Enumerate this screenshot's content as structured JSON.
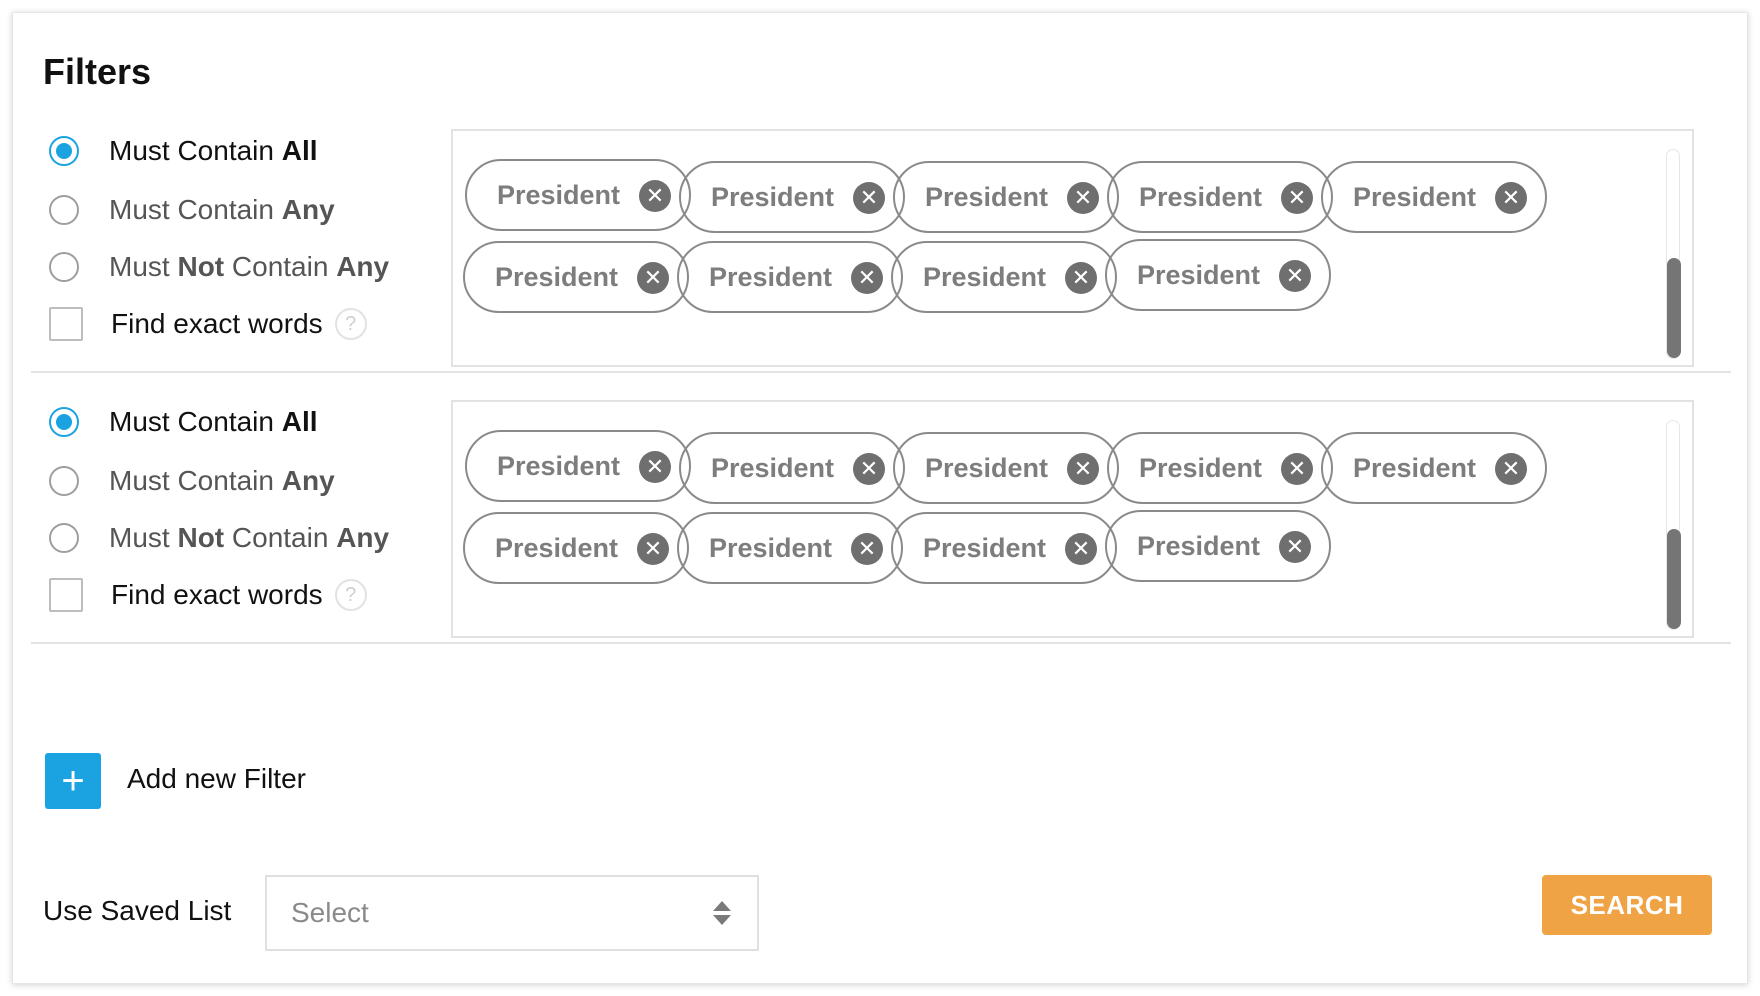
{
  "title": "Filters",
  "filters": [
    {
      "options": [
        {
          "pre": "Must Contain ",
          "bold1": "All",
          "mid": "",
          "bold2": "",
          "selected": true
        },
        {
          "pre": "Must Contain ",
          "bold1": "Any",
          "mid": "",
          "bold2": "",
          "selected": false
        },
        {
          "pre": "Must ",
          "bold1": "Not",
          "mid": " Contain ",
          "bold2": "Any",
          "selected": false
        }
      ],
      "exact_label": "Find exact words",
      "help_glyph": "?",
      "tags": [
        "President",
        "President",
        "President",
        "President",
        "President",
        "President",
        "President",
        "President",
        "President"
      ]
    },
    {
      "options": [
        {
          "pre": "Must Contain ",
          "bold1": "All",
          "mid": "",
          "bold2": "",
          "selected": true
        },
        {
          "pre": "Must Contain ",
          "bold1": "Any",
          "mid": "",
          "bold2": "",
          "selected": false
        },
        {
          "pre": "Must ",
          "bold1": "Not",
          "mid": " Contain ",
          "bold2": "Any",
          "selected": false
        }
      ],
      "exact_label": "Find exact words",
      "help_glyph": "?",
      "tags": [
        "President",
        "President",
        "President",
        "President",
        "President",
        "President",
        "President",
        "President",
        "President"
      ]
    }
  ],
  "add_filter": {
    "icon": "+",
    "label": "Add new Filter"
  },
  "saved_list": {
    "label": "Use Saved List",
    "placeholder": "Select"
  },
  "search_button": "SEARCH",
  "colors": {
    "accent": "#1aa3e0",
    "search": "#f0a345",
    "tag_border": "#8a8a8a"
  },
  "icons": {
    "remove_tag": "close-circle-icon",
    "sort": "sort-arrows-icon",
    "help": "question-icon",
    "add": "plus-icon"
  }
}
